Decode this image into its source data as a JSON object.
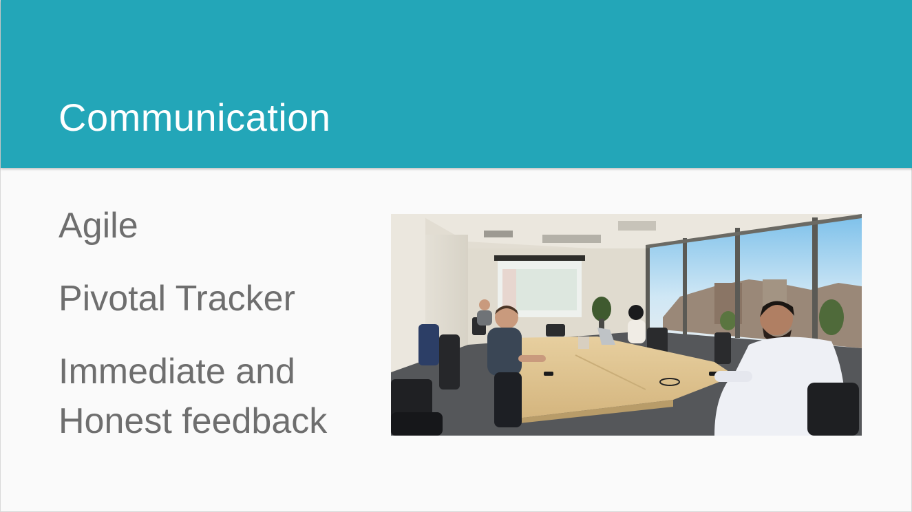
{
  "slide": {
    "title": "Communication",
    "bullets": [
      {
        "lines": [
          "Agile"
        ]
      },
      {
        "lines": [
          "Pivotal Tracker"
        ]
      },
      {
        "lines": [
          "Immediate and",
          "Honest feedback"
        ]
      }
    ]
  },
  "colors": {
    "header": "#23a6b8",
    "title_text": "#ffffff",
    "body_text": "#6e6e6e",
    "background": "#fafafa"
  },
  "photo": {
    "scene": "conference-room-meeting-photo"
  }
}
